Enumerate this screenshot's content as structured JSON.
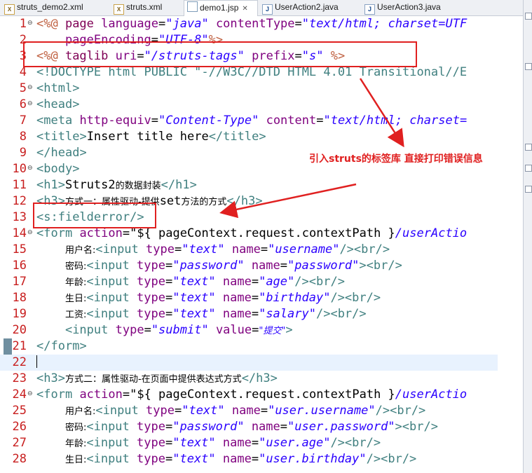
{
  "tabs": [
    {
      "label": "struts_demo2.xml",
      "icon": "xml-file-icon",
      "active": false
    },
    {
      "label": "struts.xml",
      "icon": "xml-file-icon",
      "active": false
    },
    {
      "label": "demo1.jsp",
      "icon": "jsp-file-icon",
      "active": true
    },
    {
      "label": "UserAction2.java",
      "icon": "java-file-icon",
      "active": false
    },
    {
      "label": "UserAction3.java",
      "icon": "java-file-icon",
      "active": false
    }
  ],
  "annotation": "引入struts的标签库 直接打印错误信息",
  "lines": [
    {
      "n": "1"
    },
    {
      "n": "2"
    },
    {
      "n": "3"
    },
    {
      "n": "4"
    },
    {
      "n": "5"
    },
    {
      "n": "6"
    },
    {
      "n": "7"
    },
    {
      "n": "8"
    },
    {
      "n": "9"
    },
    {
      "n": "10"
    },
    {
      "n": "11"
    },
    {
      "n": "12"
    },
    {
      "n": "13"
    },
    {
      "n": "14"
    },
    {
      "n": "15"
    },
    {
      "n": "16"
    },
    {
      "n": "17"
    },
    {
      "n": "18"
    },
    {
      "n": "19"
    },
    {
      "n": "20"
    },
    {
      "n": "21"
    },
    {
      "n": "22"
    },
    {
      "n": "23"
    },
    {
      "n": "24"
    },
    {
      "n": "25"
    },
    {
      "n": "26"
    },
    {
      "n": "27"
    },
    {
      "n": "28"
    }
  ],
  "code": {
    "l1": {
      "a": "<%@ ",
      "b": "page ",
      "c": "language",
      "d": "=",
      "e": "\"java\"",
      "f": " contentType",
      "g": "=",
      "h": "\"text/html; charset=UTF"
    },
    "l2": {
      "a": "    pageEncoding",
      "b": "=",
      "c": "\"UTF-8\"",
      "d": "%>"
    },
    "l3": {
      "a": "<%@ ",
      "b": "taglib ",
      "c": "uri",
      "d": "=",
      "e": "\"/struts-tags\"",
      "f": " prefix",
      "g": "=",
      "h": "\"s\"",
      "i": " %>"
    },
    "l4": {
      "a": "<!DOCTYPE html PUBLIC \"-//W3C//DTD HTML 4.01 Transitional//E"
    },
    "l5": {
      "a": "<",
      "b": "html",
      "c": ">"
    },
    "l6": {
      "a": "<",
      "b": "head",
      "c": ">"
    },
    "l7": {
      "a": "<",
      "b": "meta",
      "c": " http-equiv",
      "d": "=",
      "e": "\"Content-Type\"",
      "f": " content",
      "g": "=",
      "h": "\"text/html; charset="
    },
    "l8": {
      "a": "<",
      "b": "title",
      "c": ">",
      "d": "Insert title here",
      "e": "</",
      "f": "title",
      "g": ">"
    },
    "l9": {
      "a": "</",
      "b": "head",
      "c": ">"
    },
    "l10": {
      "a": "<",
      "b": "body",
      "c": ">"
    },
    "l11": {
      "a": "<",
      "b": "h1",
      "c": ">",
      "d": "Struts2",
      "e": "的数据封装",
      "f": "</",
      "g": "h1",
      "h": ">"
    },
    "l12": {
      "a": "<",
      "b": "h3",
      "c": ">",
      "d": "方式一：属性驱动-提供",
      "e": "set",
      "f": "方法的方式",
      "g": "</",
      "h": "h3",
      "i": ">"
    },
    "l13": {
      "a": "<",
      "b": "s:fielderror",
      "c": "/>"
    },
    "l14": {
      "a": "<",
      "b": "form",
      "c": " action",
      "d": "=\"${ pageContext.request.contextPath }",
      "e": "/userActio"
    },
    "l15": {
      "a": "    ",
      "b": "用户名:",
      "c": "<",
      "d": "input",
      "e": " type",
      "f": "=",
      "g": "\"text\"",
      "h": " name",
      "i": "=",
      "j": "\"username\"",
      "k": "/><",
      "l": "br",
      "m": "/>"
    },
    "l16": {
      "a": "    ",
      "b": "密码:",
      "c": "<",
      "d": "input",
      "e": " type",
      "f": "=",
      "g": "\"password\"",
      "h": " name",
      "i": "=",
      "j": "\"password\"",
      "k": "><",
      "l": "br",
      "m": "/>"
    },
    "l17": {
      "a": "    ",
      "b": "年龄:",
      "c": "<",
      "d": "input",
      "e": " type",
      "f": "=",
      "g": "\"text\"",
      "h": " name",
      "i": "=",
      "j": "\"age\"",
      "k": "/><",
      "l": "br",
      "m": "/>"
    },
    "l18": {
      "a": "    ",
      "b": "生日:",
      "c": "<",
      "d": "input",
      "e": " type",
      "f": "=",
      "g": "\"text\"",
      "h": " name",
      "i": "=",
      "j": "\"birthday\"",
      "k": "/><",
      "l": "br",
      "m": "/>"
    },
    "l19": {
      "a": "    ",
      "b": "工资:",
      "c": "<",
      "d": "input",
      "e": " type",
      "f": "=",
      "g": "\"text\"",
      "h": " name",
      "i": "=",
      "j": "\"salary\"",
      "k": "/><",
      "l": "br",
      "m": "/>"
    },
    "l20": {
      "a": "    <",
      "b": "input",
      "c": " type",
      "d": "=",
      "e": "\"submit\"",
      "f": " value",
      "g": "=",
      "h": "\"提交\"",
      "i": ">"
    },
    "l21": {
      "a": "</",
      "b": "form",
      "c": ">"
    },
    "l22": {
      "a": ""
    },
    "l23": {
      "a": "<",
      "b": "h3",
      "c": ">",
      "d": "方式二：属性驱动-在页面中提供表达式方式",
      "e": "</",
      "f": "h3",
      "g": ">"
    },
    "l24": {
      "a": "<",
      "b": "form",
      "c": " action",
      "d": "=\"${ pageContext.request.contextPath }",
      "e": "/userActio"
    },
    "l25": {
      "a": "    ",
      "b": "用户名:",
      "c": "<",
      "d": "input",
      "e": " type",
      "f": "=",
      "g": "\"text\"",
      "h": " name",
      "i": "=",
      "j": "\"user.username\"",
      "k": "/><",
      "l": "br",
      "m": "/>"
    },
    "l26": {
      "a": "    ",
      "b": "密码:",
      "c": "<",
      "d": "input",
      "e": " type",
      "f": "=",
      "g": "\"password\"",
      "h": " name",
      "i": "=",
      "j": "\"user.password\"",
      "k": "><",
      "l": "br",
      "m": "/>"
    },
    "l27": {
      "a": "    ",
      "b": "年龄:",
      "c": "<",
      "d": "input",
      "e": " type",
      "f": "=",
      "g": "\"text\"",
      "h": " name",
      "i": "=",
      "j": "\"user.age\"",
      "k": "/><",
      "l": "br",
      "m": "/>"
    },
    "l28": {
      "a": "    ",
      "b": "生日:",
      "c": "<",
      "d": "input",
      "e": " type",
      "f": "=",
      "g": "\"text\"",
      "h": " name",
      "i": "=",
      "j": "\"user.birthday\"",
      "k": "/><",
      "l": "br",
      "m": "/>"
    }
  },
  "colors": {
    "annotation_red": "#e02020",
    "line_number": "#c81e1e",
    "keyword": "#7f0055",
    "tag": "#3f7f7f",
    "attribute": "#7f007f",
    "string": "#2a00ff"
  }
}
